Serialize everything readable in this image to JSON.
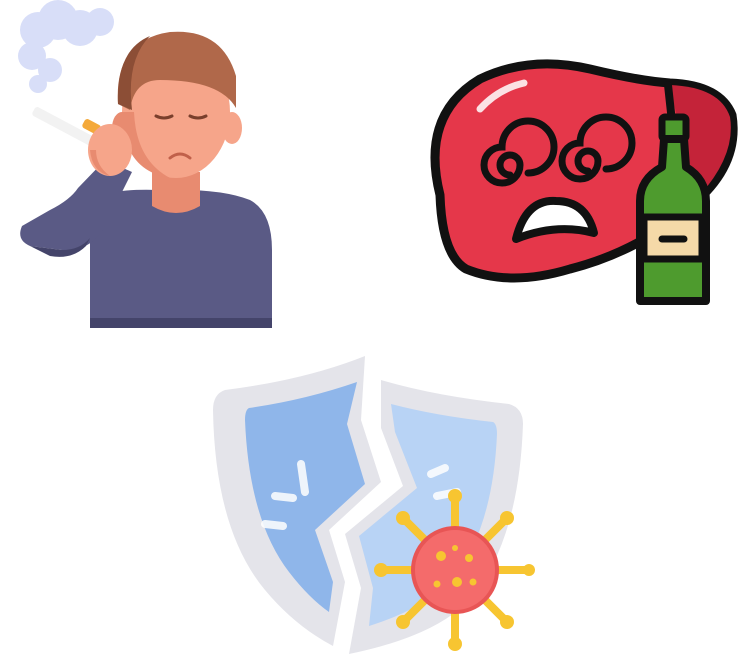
{
  "icons": [
    {
      "name": "smoking-person-icon"
    },
    {
      "name": "damaged-liver-alcohol-icon"
    },
    {
      "name": "broken-immune-shield-virus-icon"
    }
  ],
  "colors": {
    "smoke": "#d8def8",
    "skin": "#f6a58a",
    "skin_shade": "#e88b70",
    "hair": "#b0684a",
    "hair_dark": "#8c4e36",
    "shirt": "#5a5a85",
    "shirt_dark": "#44446a",
    "liver_red": "#e5374a",
    "liver_dark": "#c42339",
    "outline": "#111111",
    "bottle_green": "#4e9b2e",
    "bottle_label": "#f5d9a8",
    "shield_outer": "#e4e4ea",
    "shield_inner": "#b8d3f5",
    "shield_inner_dark": "#8fb6ea",
    "virus_body": "#f46b6b",
    "virus_spikes": "#f7c531"
  }
}
